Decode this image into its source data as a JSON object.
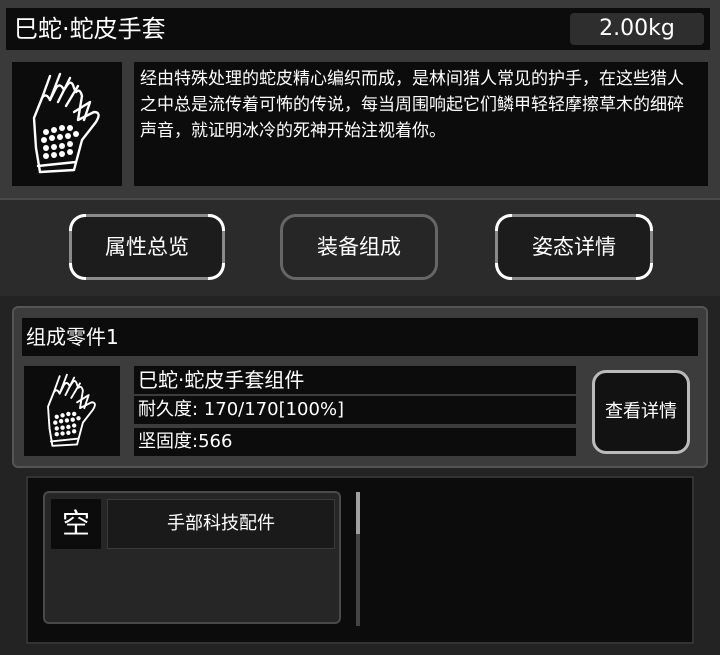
{
  "item": {
    "name": "巳蛇·蛇皮手套",
    "weight": "2.00kg",
    "description": "经由特殊处理的蛇皮精心编织而成，是林间猎人常见的护手，在这些猎人之中总是流传着可怖的传说，每当周围响起它们鳞甲轻轻摩擦草木的细碎声音，就证明冰冷的死神开始注视着你。",
    "icon": "snakeskin-gloves-icon"
  },
  "tabs": [
    {
      "label": "属性总览"
    },
    {
      "label": "装备组成"
    },
    {
      "label": "姿态详情"
    }
  ],
  "component": {
    "title": "组成零件1",
    "name": "巳蛇·蛇皮手套组件",
    "durability": "耐久度: 170/170[100%]",
    "hardness": "坚固度:566",
    "detail_button": "查看详情",
    "icon": "snakeskin-gloves-icon"
  },
  "slot": {
    "empty_label": "空",
    "name": "手部科技配件"
  }
}
